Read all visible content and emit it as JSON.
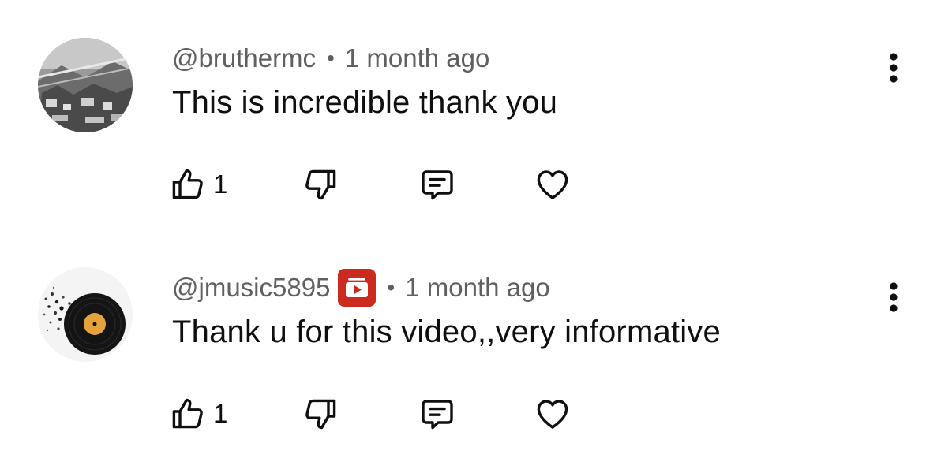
{
  "comments": [
    {
      "handle": "@bruthermc",
      "separator": "•",
      "time": "1 month ago",
      "text": "This is incredible thank you",
      "like_count": "1",
      "avatar_icon": "city-rooftops-avatar",
      "has_badge": false
    },
    {
      "handle": "@jmusic5895",
      "separator": "•",
      "time": "1 month ago",
      "text": "Thank u for this video,,very informative",
      "like_count": "1",
      "avatar_icon": "vinyl-record-avatar",
      "has_badge": true,
      "badge_icon": "youtube-creator-badge-icon",
      "badge_color": "#cc2a1f"
    }
  ],
  "icons": {
    "like": "thumbs-up-icon",
    "dislike": "thumbs-down-icon",
    "reply": "reply-comment-icon",
    "heart": "heart-icon",
    "more": "more-vertical-icon"
  },
  "colors": {
    "text": "#0f0f0f",
    "meta": "#606060",
    "background": "#ffffff"
  }
}
